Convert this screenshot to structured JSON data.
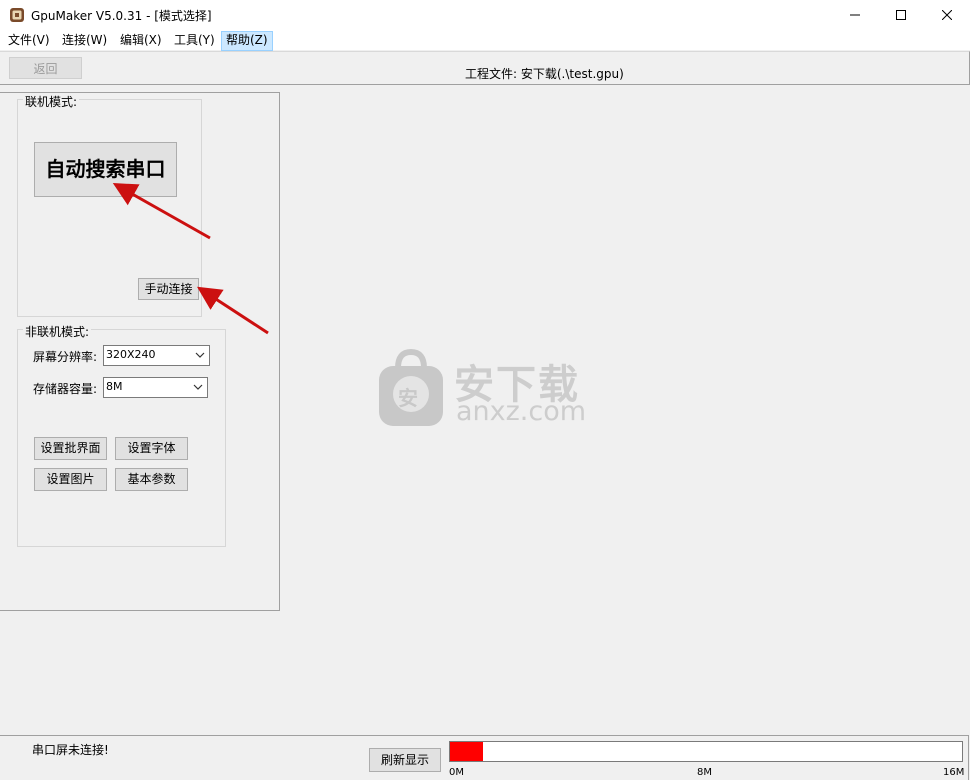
{
  "window": {
    "title": "GpuMaker V5.0.31 - [模式选择]"
  },
  "menu": {
    "items": [
      {
        "label": "文件(V)"
      },
      {
        "label": "连接(W)"
      },
      {
        "label": "编辑(X)"
      },
      {
        "label": "工具(Y)"
      },
      {
        "label": "帮助(Z)"
      }
    ]
  },
  "toolbar": {
    "back_label": "返回",
    "project_file": "工程文件: 安下载(.\\test.gpu)"
  },
  "online": {
    "group_label": "联机模式:",
    "auto_search_label": "自动搜索串口",
    "manual_connect_label": "手动连接"
  },
  "offline": {
    "group_label": "非联机模式:",
    "resolution_label": "屏幕分辨率:",
    "resolution_value": "320X240",
    "storage_label": "存储器容量:",
    "storage_value": "8M",
    "buttons": {
      "batch_ui": "设置批界面",
      "font": "设置字体",
      "image": "设置图片",
      "basic_params": "基本参数"
    }
  },
  "watermark": {
    "cn": "安下载",
    "en": "anxz.com",
    "badge": "安"
  },
  "status": {
    "text": "串口屏未连接!",
    "refresh_label": "刷新显示",
    "memory": {
      "used_fraction": 0.065,
      "ticks": [
        "0M",
        "8M",
        "16M"
      ]
    }
  },
  "colors": {
    "memory_fill": "#ff0000",
    "arrow": "#cc1010",
    "menu_highlight": "#cce8ff"
  }
}
